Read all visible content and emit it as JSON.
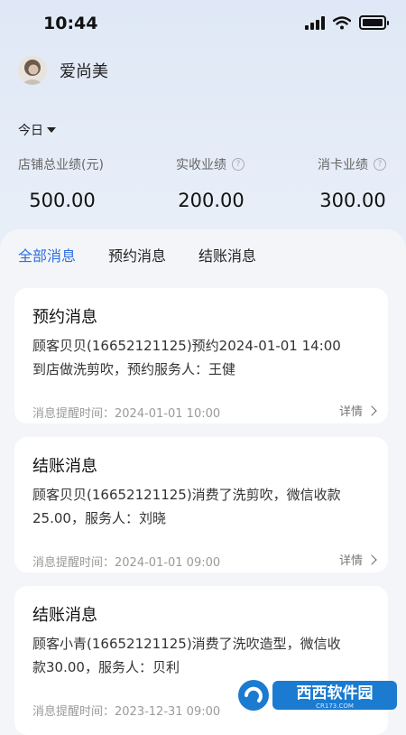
{
  "status_bar": {
    "time": "10:44"
  },
  "user": {
    "name": "爱尚美"
  },
  "filter": {
    "label": "今日"
  },
  "stats": [
    {
      "label": "店铺总业绩(元)",
      "value": "500.00",
      "help": false
    },
    {
      "label": "实收业绩",
      "value": "200.00",
      "help": true
    },
    {
      "label": "消卡业绩",
      "value": "300.00",
      "help": true
    }
  ],
  "tabs": [
    {
      "label": "全部消息",
      "active": true
    },
    {
      "label": "预约消息",
      "active": false
    },
    {
      "label": "结账消息",
      "active": false
    }
  ],
  "messages": [
    {
      "title": "预约消息",
      "line1": "顾客贝贝(16652121125)预约2024-01-01 14:00",
      "line2": "到店做洗剪吹，预约服务人：王健",
      "time": "消息提醒时间：2024-01-01 10:00",
      "detail": "详情"
    },
    {
      "title": "结账消息",
      "line1": "顾客贝贝(16652121125)消费了洗剪吹，微信收款",
      "line2": "25.00，服务人：刘晓",
      "time": "消息提醒时间：2024-01-01 09:00",
      "detail": "详情"
    },
    {
      "title": "结账消息",
      "line1": "顾客小青(16652121125)消费了洗吹造型，微信收",
      "line2": "款30.00，服务人：贝利",
      "time": "消息提醒时间：2023-12-31 09:00",
      "detail": ""
    }
  ],
  "watermark": {
    "text": "西西软件园",
    "sub": "CR173.COM"
  },
  "colors": {
    "accent": "#2f6fe0",
    "background": "#e4ecf7",
    "card": "#ffffff"
  }
}
